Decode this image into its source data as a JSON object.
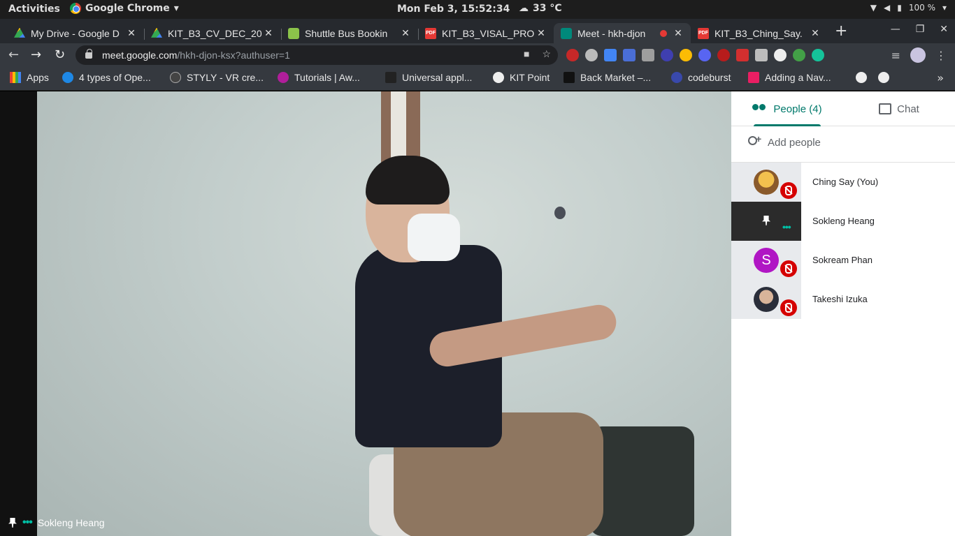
{
  "system": {
    "activities": "Activities",
    "app_name": "Google Chrome",
    "clock": "Mon Feb  3, 15:52:34",
    "weather": "33 °C",
    "battery": "100 %"
  },
  "tabs": [
    {
      "label": "My Drive - Google D",
      "icon": "drive-icon"
    },
    {
      "label": "KIT_B3_CV_DEC_20",
      "icon": "drive-icon"
    },
    {
      "label": "Shuttle Bus Bookin",
      "icon": "bus-icon"
    },
    {
      "label": "KIT_B3_VISAL_PRO",
      "icon": "pdf-icon"
    },
    {
      "label": "Meet - hkh-djon",
      "icon": "meet-icon",
      "active": true
    },
    {
      "label": "KIT_B3_Ching_Say.",
      "icon": "pdf-icon"
    }
  ],
  "address_bar": {
    "host": "meet.google.com",
    "path": "/hkh-djon-ksx?authuser=1"
  },
  "bookmarks": [
    {
      "label": "Apps"
    },
    {
      "label": "4 types of Ope..."
    },
    {
      "label": "STYLY - VR cre..."
    },
    {
      "label": "Tutorials | Aw..."
    },
    {
      "label": "Universal appl..."
    },
    {
      "label": "KIT Point"
    },
    {
      "label": "Back Market –..."
    },
    {
      "label": "codeburst"
    },
    {
      "label": "Adding a Nav..."
    }
  ],
  "stage": {
    "speaker_name": "Sokleng Heang"
  },
  "panel": {
    "tab_people": "People (4)",
    "tab_chat": "Chat",
    "add_people": "Add people",
    "participants": [
      {
        "name": "Ching Say (You)",
        "status": "muted"
      },
      {
        "name": "Sokleng Heang",
        "status": "speaking"
      },
      {
        "name": "Sokream Phan",
        "initial": "S",
        "status": "muted"
      },
      {
        "name": "Takeshi Izuka",
        "status": "muted"
      }
    ]
  },
  "colors": {
    "meet_accent": "#00796b",
    "mute_red": "#d50000",
    "speaking_teal": "#00bfa5"
  }
}
